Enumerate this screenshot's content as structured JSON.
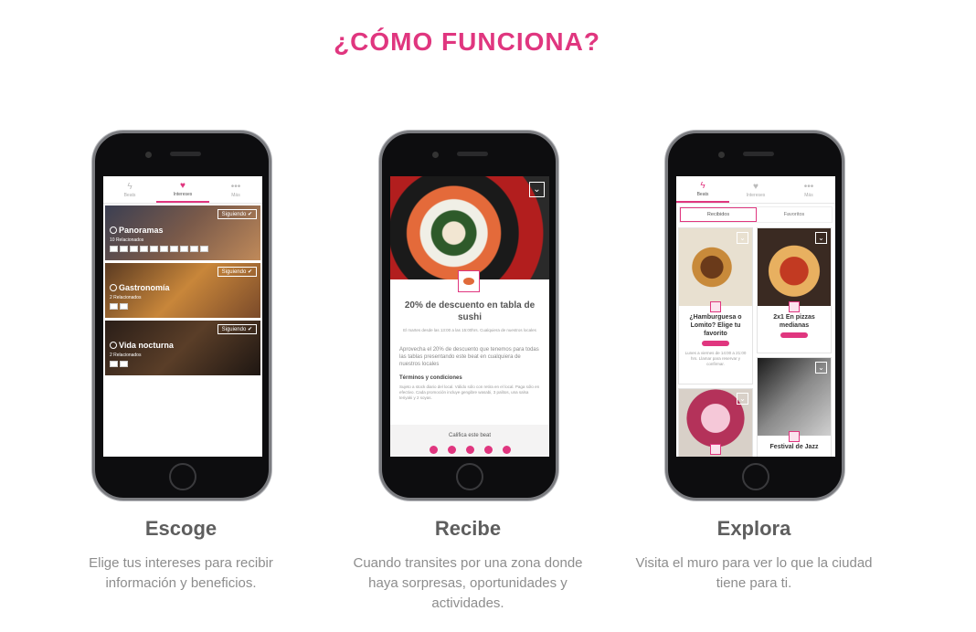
{
  "page": {
    "title": "¿CÓMO FUNCIONA?"
  },
  "colors": {
    "accent": "#e0367f"
  },
  "steps": [
    {
      "title": "Escoge",
      "description": "Elige tus intereses para recibir información y beneficios."
    },
    {
      "title": "Recibe",
      "description": "Cuando transites por una zona donde haya sorpresas, oportunidades y actividades."
    },
    {
      "title": "Explora",
      "description": "Visita el muro para ver lo que la ciudad tiene para ti."
    }
  ],
  "app_tabs": [
    {
      "label": "Beats",
      "icon": "bolt-icon"
    },
    {
      "label": "Intereses",
      "icon": "heart-icon"
    },
    {
      "label": "Más",
      "icon": "more-dots-icon"
    }
  ],
  "screen1": {
    "interests": [
      {
        "name": "Panoramas",
        "count": "10 Relacionados",
        "follow": "Siguiendo ✔"
      },
      {
        "name": "Gastronomía",
        "count": "2 Relacionados",
        "follow": "Siguiendo ✔"
      },
      {
        "name": "Vida nocturna",
        "count": "2 Relacionados",
        "follow": "Siguiendo ✔"
      }
    ]
  },
  "screen2": {
    "offer_title": "20% de descuento en tabla de sushi",
    "offer_schedule": "El martes desde las 13:00 a las 15:00hrs. Cualquiera de nuestros locales",
    "offer_description": "Aprovecha el 20% de descuento que tenemos para todas las tablas presentando este beat en cualquiera de nuestros locales",
    "terms_title": "Términos y condiciones",
    "terms_text": "Sujeto a stock diario del local. Válido sólo con retira en el local. Paga sólo en efectivo. Cada promoción incluye gengibre wasabi, 3 palitos, una salsa teriyaki y 2 soyas.",
    "rate_label": "Califica este beat"
  },
  "screen3": {
    "segments": [
      "Recibidos",
      "Favoritos"
    ],
    "tiles": [
      {
        "title": "¿Hamburguesa o Lomito? Elige tu favorito",
        "pill": "",
        "description": "Lunes a viernes de 14:00 a 21:00 hrs. Llamar para reservar y confirmar."
      },
      {
        "title": "2x1 En pizzas medianas",
        "pill": ""
      },
      {
        "title": ""
      },
      {
        "title": "Festival de Jazz"
      }
    ]
  }
}
